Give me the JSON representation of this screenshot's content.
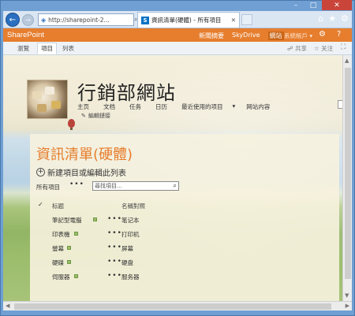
{
  "browser": {
    "url": "http://sharepoint-2...",
    "tab_title": "資訊清單(硬體) - 所有項目",
    "tab_icon_letter": "S"
  },
  "suite_bar": {
    "brand": "SharePoint",
    "links": [
      "新聞摘要",
      "SkyDrive",
      "網站"
    ],
    "active_link": "網站",
    "user": "系統帳戶 ▾",
    "color": "#e67e2e"
  },
  "ribbon": {
    "tabs": [
      "瀏覽",
      "項目",
      "列表"
    ],
    "active_tab": "瀏覽",
    "share": "☍ 共享",
    "follow": "☆ 关注"
  },
  "site": {
    "title": "行銷部網站",
    "nav": [
      "主页",
      "文档",
      "任务",
      "日历",
      "最近使用的项目",
      "▾",
      "网站内容"
    ],
    "edit_links": "編輯鏈接"
  },
  "list": {
    "title": "資訊清單(硬體)",
    "new_item": "新建項目或編輯此列表",
    "view": "所有項目",
    "search_placeholder": "尋找項目...",
    "columns": [
      "标题",
      "名稱對照"
    ],
    "rows": [
      {
        "title": "筆記型電腦",
        "value": "笔记本"
      },
      {
        "title": "印表機",
        "value": "打印机"
      },
      {
        "title": "螢幕",
        "value": "屏幕"
      },
      {
        "title": "硬碟",
        "value": "硬盘"
      },
      {
        "title": "伺服器",
        "value": "服务器"
      }
    ],
    "title_color": "#e67e2e"
  }
}
